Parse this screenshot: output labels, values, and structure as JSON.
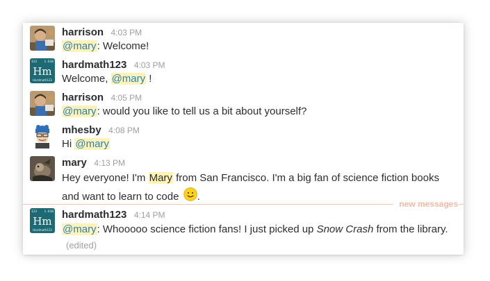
{
  "divider": {
    "label": "new messages"
  },
  "messages": [
    {
      "user": "harrison",
      "time": "4:03 PM",
      "mention": "@mary",
      "text": ": Welcome!"
    },
    {
      "user": "hardmath123",
      "time": "4:03 PM",
      "pre": "Welcome, ",
      "mention": "@mary",
      "post": " !"
    },
    {
      "user": "harrison",
      "time": "4:05 PM",
      "mention": "@mary",
      "text": ": would you like to tell us a bit about yourself?"
    },
    {
      "user": "mhesby",
      "time": "4:08 PM",
      "pre": "Hi ",
      "mention": "@mary"
    },
    {
      "user": "mary",
      "time": "4:13 PM",
      "pre": "Hey everyone! I'm ",
      "highlight": "Mary",
      "mid": " from San Francisco. I'm a big fan of science fiction books and want to learn to code ",
      "emoji": "slightly-smiling-face-icon",
      "end": "."
    },
    {
      "user": "hardmath123",
      "time": "4:14 PM",
      "mention": "@mary",
      "text": ": Whooooo science fiction fans! I just picked up ",
      "italic": "Snow Crash",
      "post": " from the library.",
      "edited": "(edited)"
    }
  ],
  "avatars": {
    "hardmath123": {
      "top_left": "123",
      "top_right": "1.618",
      "symbol": "Hm",
      "caption": "Hardmath123",
      "color": "#1d6a74"
    }
  },
  "colors": {
    "mention_bg": "#fff3b8",
    "mention_text": "#2a80b9",
    "divider": "#f2c4b4"
  }
}
